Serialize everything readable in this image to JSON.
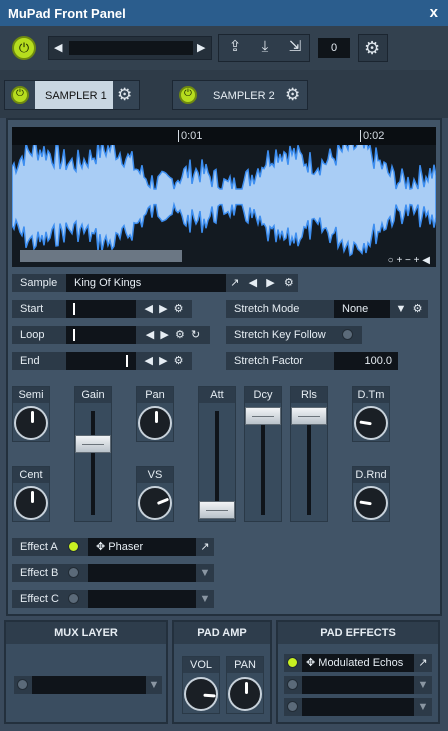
{
  "window": {
    "title": "MuPad Front Panel",
    "close_label": "x"
  },
  "toolbar": {
    "counter": "0",
    "nav_prev": "◀",
    "nav_next": "▶"
  },
  "tabs": [
    {
      "label": "SAMPLER 1",
      "active": true
    },
    {
      "label": "SAMPLER 2",
      "active": false
    }
  ],
  "waveform": {
    "ruler_labels": [
      "0:01",
      "0:02"
    ],
    "controls": "○ + − + ◀"
  },
  "sample": {
    "label": "Sample",
    "value": "King Of Kings"
  },
  "start": {
    "label": "Start"
  },
  "loop": {
    "label": "Loop"
  },
  "end": {
    "label": "End"
  },
  "stretch": {
    "mode_label": "Stretch Mode",
    "mode_value": "None",
    "key_follow_label": "Stretch Key Follow",
    "factor_label": "Stretch Factor",
    "factor_value": "100.0"
  },
  "knobs": {
    "semi": {
      "label": "Semi",
      "level": 0.5
    },
    "cent": {
      "label": "Cent",
      "level": 0.5
    },
    "pan": {
      "label": "Pan",
      "level": 0.5
    },
    "vs": {
      "label": "VS",
      "level": 0.75
    },
    "dtm": {
      "label": "D.Tm",
      "level": 0.2
    },
    "drnd": {
      "label": "D.Rnd",
      "level": 0.2
    }
  },
  "sliders": {
    "gain": {
      "label": "Gain",
      "level": 0.7
    },
    "att": {
      "label": "Att",
      "level": 0.0
    },
    "dcy": {
      "label": "Dcy",
      "level": 1.0
    },
    "rls": {
      "label": "Rls",
      "level": 1.0
    }
  },
  "effects": [
    {
      "label": "Effect A",
      "value": "Phaser",
      "on": true
    },
    {
      "label": "Effect B",
      "value": "",
      "on": false
    },
    {
      "label": "Effect C",
      "value": "",
      "on": false
    }
  ],
  "mux_layer": {
    "title": "MUX LAYER"
  },
  "pad_amp": {
    "title": "PAD AMP",
    "vol": {
      "label": "VOL",
      "level": 0.85
    },
    "pan": {
      "label": "PAN",
      "level": 0.5
    }
  },
  "pad_effects": {
    "title": "PAD EFFECTS",
    "slots": [
      {
        "value": "Modulated Echos",
        "on": true
      },
      {
        "value": "",
        "on": false
      },
      {
        "value": "",
        "on": false
      }
    ]
  },
  "colors": {
    "accent": "#b6dd1e",
    "titlebar": "#2b5d8d",
    "wave": "#a9cdf5"
  }
}
